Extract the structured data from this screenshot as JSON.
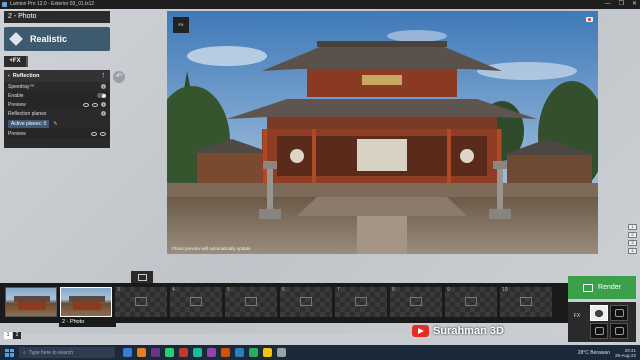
{
  "window": {
    "title": "Lumion Pro 12.0 - Exterior 03_01.ls12",
    "buttons": [
      "—",
      "❐",
      "✕"
    ]
  },
  "photo_title": "2 - Photo",
  "style": {
    "label": "Realistic"
  },
  "fx_button": "+FX",
  "fx_panel": {
    "header": "Reflection",
    "rows": [
      {
        "label": "Speedray™"
      },
      {
        "label": "Enable"
      },
      {
        "label": "Preview"
      },
      {
        "label": "Reflection planes"
      }
    ],
    "active_planes": "Active planes: 0",
    "bottom_preview": "Preview"
  },
  "viewport": {
    "fx_label": "FX",
    "status": "Photo preview will automatically update"
  },
  "side_tools": [
    "1",
    "2",
    "3",
    "4"
  ],
  "filmstrip": {
    "slots": [
      {
        "num": "",
        "type": "thumb"
      },
      {
        "num": "",
        "type": "thumb",
        "selected": true
      },
      {
        "num": "3",
        "type": "empty"
      },
      {
        "num": "4",
        "type": "empty"
      },
      {
        "num": "5",
        "type": "empty"
      },
      {
        "num": "6",
        "type": "empty"
      },
      {
        "num": "7",
        "type": "empty"
      },
      {
        "num": "8",
        "type": "empty"
      },
      {
        "num": "9",
        "type": "empty"
      },
      {
        "num": "10",
        "type": "empty"
      }
    ],
    "selected_label": "2 - Photo"
  },
  "pager": [
    "1",
    "2"
  ],
  "render_button": "Render",
  "mode_panel": {
    "fx": "FX"
  },
  "watermark": "Surahman 3D",
  "taskbar": {
    "search_placeholder": "Type here to search",
    "weather": "28°C  Berawan",
    "time": "20:41",
    "date": "29-Aug-22",
    "icon_colors": [
      "#3a7bd5",
      "#e67e22",
      "#6c3483",
      "#2ecc71",
      "#c0392b",
      "#1abc9c",
      "#8e44ad",
      "#d35400",
      "#2980b9",
      "#27ae60",
      "#f1c40f",
      "#95a5a6"
    ]
  }
}
